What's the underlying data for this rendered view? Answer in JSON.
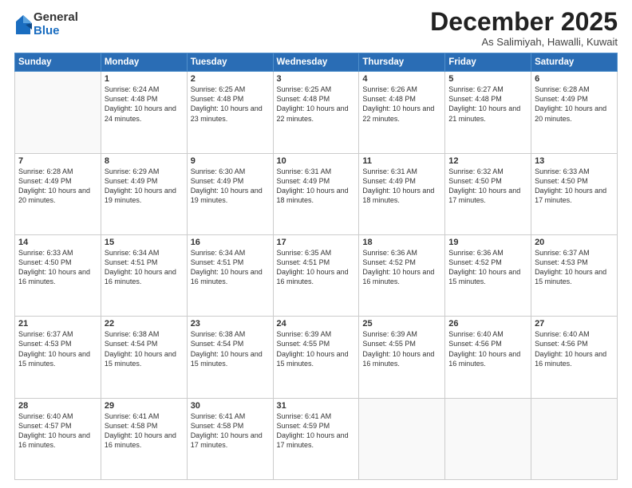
{
  "logo": {
    "general": "General",
    "blue": "Blue"
  },
  "header": {
    "month_title": "December 2025",
    "subtitle": "As Salimiyah, Hawalli, Kuwait"
  },
  "days_of_week": [
    "Sunday",
    "Monday",
    "Tuesday",
    "Wednesday",
    "Thursday",
    "Friday",
    "Saturday"
  ],
  "weeks": [
    [
      {
        "day": "",
        "info": ""
      },
      {
        "day": "1",
        "info": "Sunrise: 6:24 AM\nSunset: 4:48 PM\nDaylight: 10 hours and 24 minutes."
      },
      {
        "day": "2",
        "info": "Sunrise: 6:25 AM\nSunset: 4:48 PM\nDaylight: 10 hours and 23 minutes."
      },
      {
        "day": "3",
        "info": "Sunrise: 6:25 AM\nSunset: 4:48 PM\nDaylight: 10 hours and 22 minutes."
      },
      {
        "day": "4",
        "info": "Sunrise: 6:26 AM\nSunset: 4:48 PM\nDaylight: 10 hours and 22 minutes."
      },
      {
        "day": "5",
        "info": "Sunrise: 6:27 AM\nSunset: 4:48 PM\nDaylight: 10 hours and 21 minutes."
      },
      {
        "day": "6",
        "info": "Sunrise: 6:28 AM\nSunset: 4:49 PM\nDaylight: 10 hours and 20 minutes."
      }
    ],
    [
      {
        "day": "7",
        "info": "Sunrise: 6:28 AM\nSunset: 4:49 PM\nDaylight: 10 hours and 20 minutes."
      },
      {
        "day": "8",
        "info": "Sunrise: 6:29 AM\nSunset: 4:49 PM\nDaylight: 10 hours and 19 minutes."
      },
      {
        "day": "9",
        "info": "Sunrise: 6:30 AM\nSunset: 4:49 PM\nDaylight: 10 hours and 19 minutes."
      },
      {
        "day": "10",
        "info": "Sunrise: 6:31 AM\nSunset: 4:49 PM\nDaylight: 10 hours and 18 minutes."
      },
      {
        "day": "11",
        "info": "Sunrise: 6:31 AM\nSunset: 4:49 PM\nDaylight: 10 hours and 18 minutes."
      },
      {
        "day": "12",
        "info": "Sunrise: 6:32 AM\nSunset: 4:50 PM\nDaylight: 10 hours and 17 minutes."
      },
      {
        "day": "13",
        "info": "Sunrise: 6:33 AM\nSunset: 4:50 PM\nDaylight: 10 hours and 17 minutes."
      }
    ],
    [
      {
        "day": "14",
        "info": "Sunrise: 6:33 AM\nSunset: 4:50 PM\nDaylight: 10 hours and 16 minutes."
      },
      {
        "day": "15",
        "info": "Sunrise: 6:34 AM\nSunset: 4:51 PM\nDaylight: 10 hours and 16 minutes."
      },
      {
        "day": "16",
        "info": "Sunrise: 6:34 AM\nSunset: 4:51 PM\nDaylight: 10 hours and 16 minutes."
      },
      {
        "day": "17",
        "info": "Sunrise: 6:35 AM\nSunset: 4:51 PM\nDaylight: 10 hours and 16 minutes."
      },
      {
        "day": "18",
        "info": "Sunrise: 6:36 AM\nSunset: 4:52 PM\nDaylight: 10 hours and 16 minutes."
      },
      {
        "day": "19",
        "info": "Sunrise: 6:36 AM\nSunset: 4:52 PM\nDaylight: 10 hours and 15 minutes."
      },
      {
        "day": "20",
        "info": "Sunrise: 6:37 AM\nSunset: 4:53 PM\nDaylight: 10 hours and 15 minutes."
      }
    ],
    [
      {
        "day": "21",
        "info": "Sunrise: 6:37 AM\nSunset: 4:53 PM\nDaylight: 10 hours and 15 minutes."
      },
      {
        "day": "22",
        "info": "Sunrise: 6:38 AM\nSunset: 4:54 PM\nDaylight: 10 hours and 15 minutes."
      },
      {
        "day": "23",
        "info": "Sunrise: 6:38 AM\nSunset: 4:54 PM\nDaylight: 10 hours and 15 minutes."
      },
      {
        "day": "24",
        "info": "Sunrise: 6:39 AM\nSunset: 4:55 PM\nDaylight: 10 hours and 15 minutes."
      },
      {
        "day": "25",
        "info": "Sunrise: 6:39 AM\nSunset: 4:55 PM\nDaylight: 10 hours and 16 minutes."
      },
      {
        "day": "26",
        "info": "Sunrise: 6:40 AM\nSunset: 4:56 PM\nDaylight: 10 hours and 16 minutes."
      },
      {
        "day": "27",
        "info": "Sunrise: 6:40 AM\nSunset: 4:56 PM\nDaylight: 10 hours and 16 minutes."
      }
    ],
    [
      {
        "day": "28",
        "info": "Sunrise: 6:40 AM\nSunset: 4:57 PM\nDaylight: 10 hours and 16 minutes."
      },
      {
        "day": "29",
        "info": "Sunrise: 6:41 AM\nSunset: 4:58 PM\nDaylight: 10 hours and 16 minutes."
      },
      {
        "day": "30",
        "info": "Sunrise: 6:41 AM\nSunset: 4:58 PM\nDaylight: 10 hours and 17 minutes."
      },
      {
        "day": "31",
        "info": "Sunrise: 6:41 AM\nSunset: 4:59 PM\nDaylight: 10 hours and 17 minutes."
      },
      {
        "day": "",
        "info": ""
      },
      {
        "day": "",
        "info": ""
      },
      {
        "day": "",
        "info": ""
      }
    ]
  ]
}
